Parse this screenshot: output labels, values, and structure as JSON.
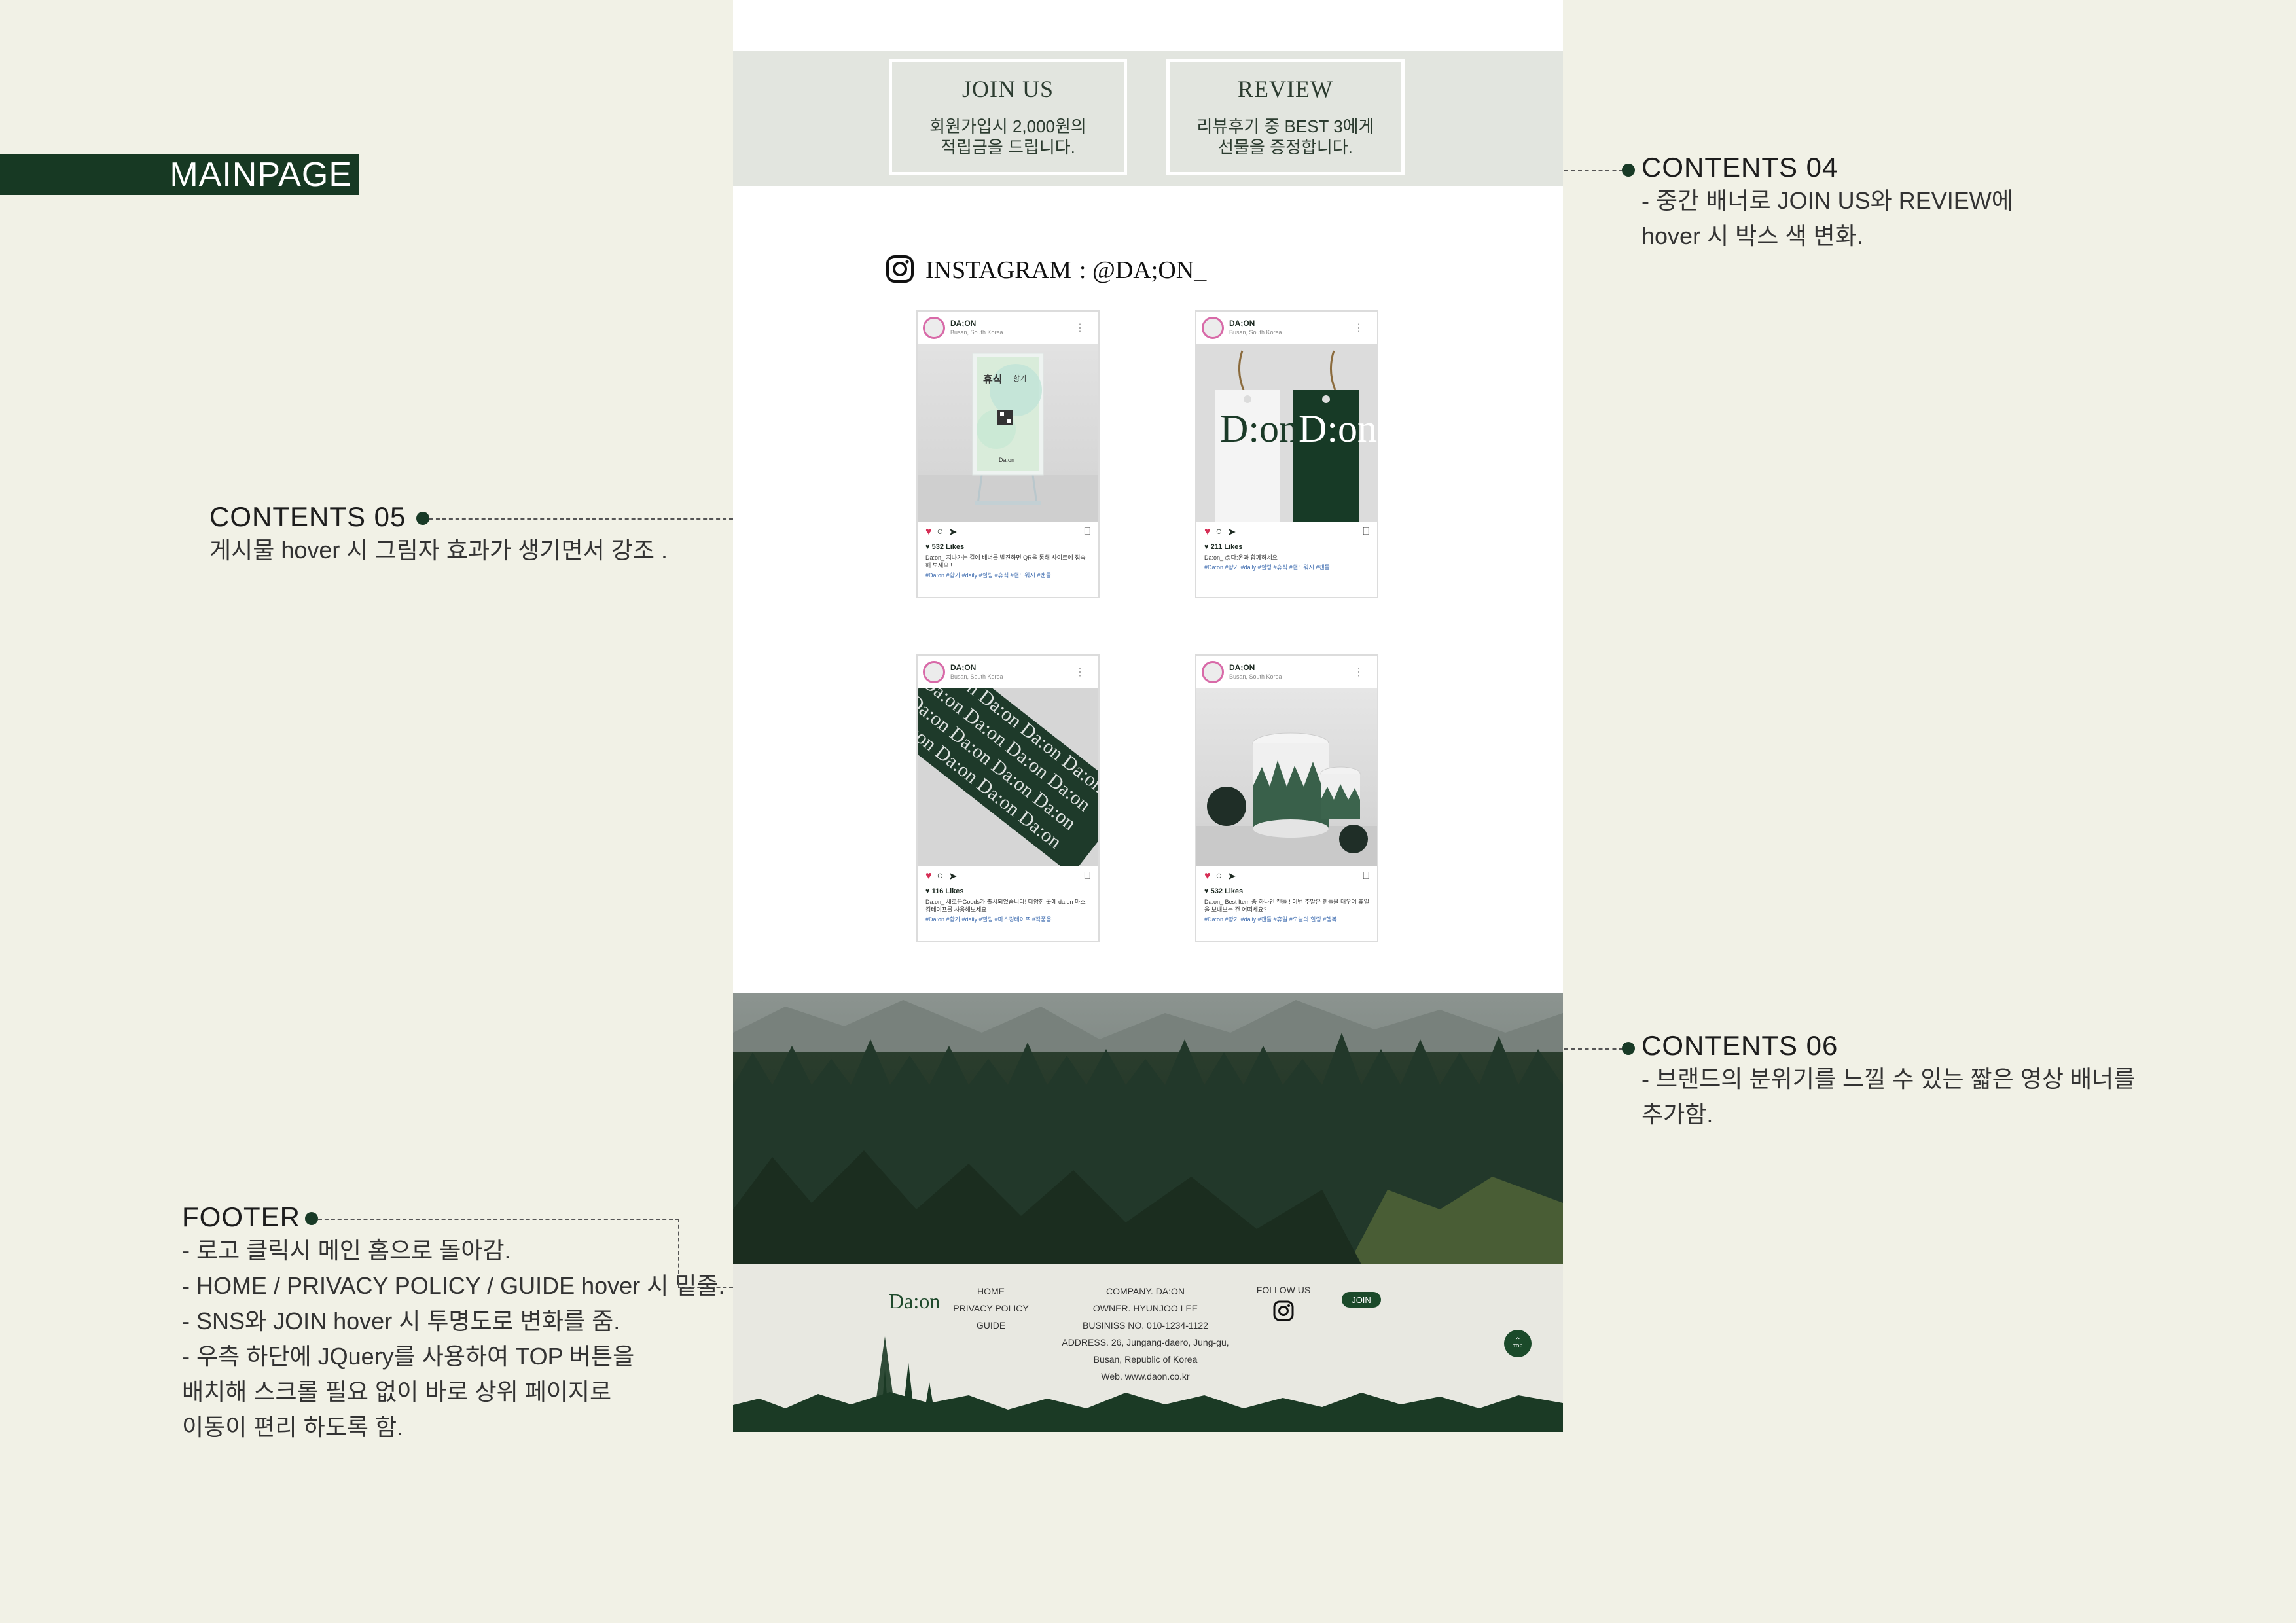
{
  "tag": {
    "label": "MAINPAGE"
  },
  "annotations": {
    "c04": {
      "title": "CONTENTS 04",
      "lines": [
        "- 중간 배너로 JOIN US와 REVIEW에",
        "hover 시 박스 색 변화."
      ]
    },
    "c05": {
      "title": "CONTENTS 05",
      "lines": [
        "게시물 hover 시 그림자 효과가 생기면서 강조 ."
      ]
    },
    "c06": {
      "title": "CONTENTS 06",
      "lines": [
        "- 브랜드의 분위기를 느낄 수 있는 짧은 영상 배너를",
        "추가함."
      ]
    },
    "footer": {
      "title": "FOOTER",
      "lines": [
        "- 로고 클릭시 메인 홈으로 돌아감.",
        "- HOME / PRIVACY POLICY / GUIDE hover 시 밑줄.",
        "- SNS와 JOIN hover 시 투명도로 변화를 줌.",
        "- 우측 하단에 JQuery를 사용하여 TOP 버튼을",
        "배치해 스크롤 필요 없이  바로 상위 페이지로",
        "이동이 편리 하도록 함."
      ]
    }
  },
  "banner": {
    "join": {
      "title": "JOIN US",
      "line1": "회원가입시 2,000원의",
      "line2": "적립금을 드립니다."
    },
    "review": {
      "title": "REVIEW",
      "line1": "리뷰후기 중 BEST 3에게",
      "line2": "선물을 증정합니다."
    }
  },
  "instagram": {
    "label": "INSTAGRAM",
    "handle": ": @DA;ON_",
    "posts": [
      {
        "user": "DA;ON_",
        "location": "Busan, South Korea",
        "likes": "♥ 532 Likes",
        "caption": "Da:on_ 지나가는 길에 배너를 발견하면 QR을 통해 사이트에 접속해 보세요 !",
        "tags": "#Da:on #향기 #daily #힐링 #휴식 #핸드워시 #캔들"
      },
      {
        "user": "DA;ON_",
        "location": "Busan, South Korea",
        "likes": "♥ 211 Likes",
        "caption": "Da:on_ @다:온과 함께하세요",
        "tags": "#Da:on #향기 #daily #힐링 #휴식 #핸드워시 #캔들"
      },
      {
        "user": "DA;ON_",
        "location": "Busan, South Korea",
        "likes": "♥ 116 Likes",
        "caption": "Da:on_ 새로운Goods가 출시되었습니다! 다양한 곳에 da:on 마스킹테이프를 사용해보세요",
        "tags": "#Da:on #향기 #daily #힐링 #마스킹테이프 #작품용"
      },
      {
        "user": "DA;ON_",
        "location": "Busan, South Korea",
        "likes": "♥ 532 Likes",
        "caption": "Da:on_ Best Item 중 하나인 캔들 ! 이번 주말은 캔들을 태우며 휴일을 보내보는 건 어떠세요?",
        "tags": "#Da:on #향기 #daily #캔들 #휴일 #오늘의 힐링 #행복"
      }
    ],
    "post1_art": {
      "title": "휴식",
      "sub": "향기",
      "brand": "Da:on"
    },
    "post2_art": {
      "letters": "D:on"
    },
    "post3_art": {
      "pattern": "Da:on"
    }
  },
  "footer": {
    "logo": "Da:on",
    "nav": [
      "HOME",
      "PRIVACY POLICY",
      "GUIDE"
    ],
    "info": [
      "COMPANY. DA:ON",
      "OWNER. HYUNJOO LEE",
      "BUSINISS NO. 010-1234-1122",
      "ADDRESS. 26, Jungang-daero, Jung-gu,",
      "Busan, Republic of Korea",
      "Web. www.daon.co.kr"
    ],
    "follow_label": "FOLLOW US",
    "join_label": "JOIN",
    "top_label": "TOP"
  },
  "colors": {
    "brand_green": "#173923",
    "page_bg": "#f1f1e6",
    "banner_bg": "#e2e5df",
    "footer_bg": "#e8e8e1"
  },
  "icons": [
    "instagram-icon",
    "heart-icon",
    "comment-icon",
    "send-icon",
    "bookmark-icon",
    "chevron-up-icon"
  ]
}
